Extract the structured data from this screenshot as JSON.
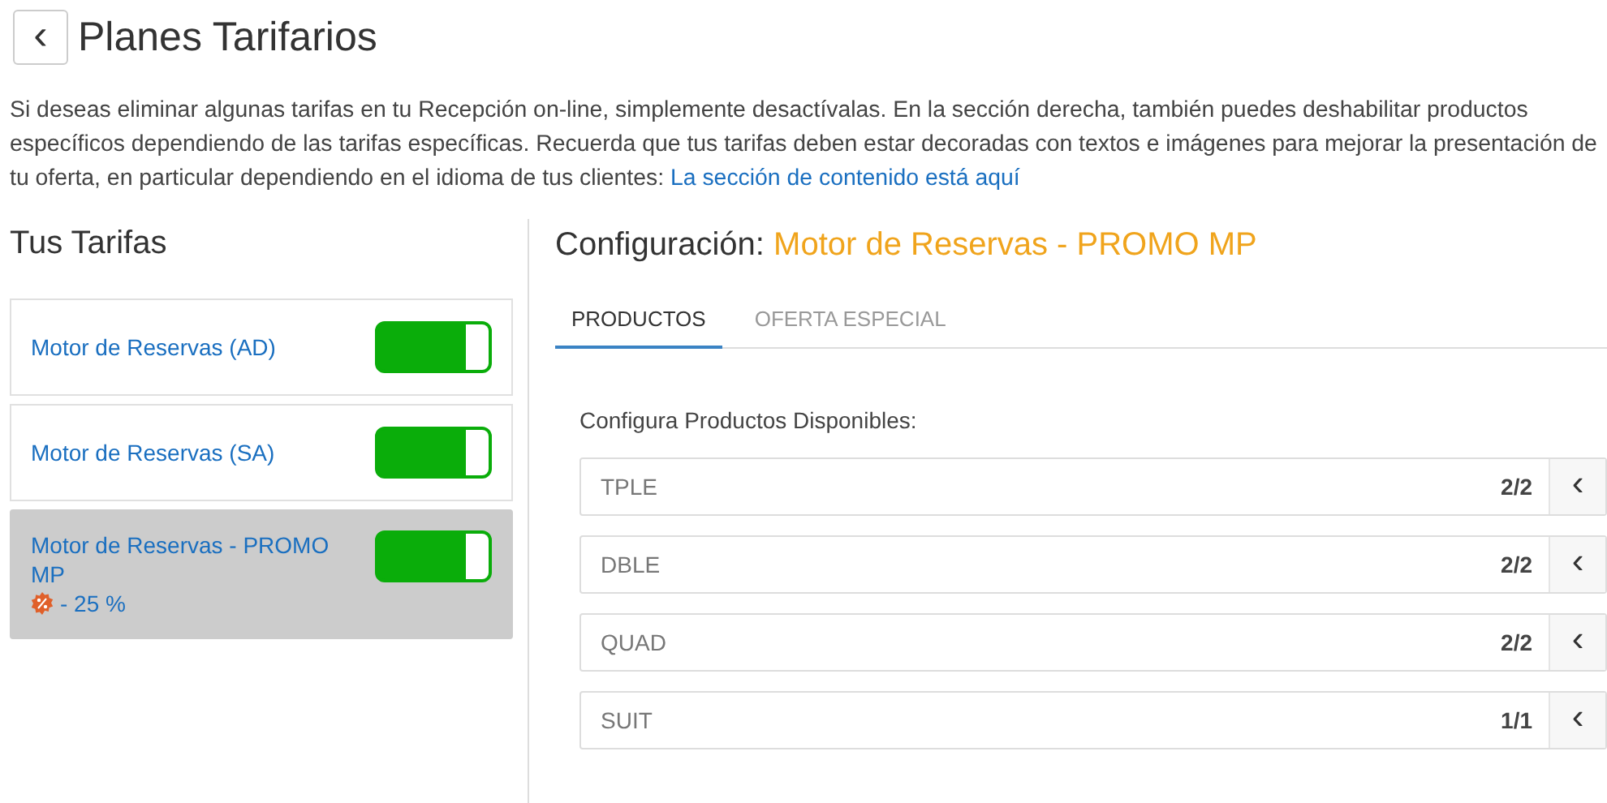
{
  "header": {
    "back_button": "‹",
    "title": "Planes Tarifarios"
  },
  "intro": {
    "text": "Si deseas eliminar algunas tarifas en tu Recepción on-line, simplemente desactívalas. En la sección derecha, también puedes deshabilitar productos específicos dependiendo de las tarifas específicas. Recuerda que tus tarifas deben estar decoradas con textos e imágenes para mejorar la presentación de tu oferta, en particular dependiendo en el idioma de tus clientes:",
    "link": "La sección de contenido está aquí"
  },
  "rates": {
    "title": "Tus Tarifas",
    "items": [
      {
        "name": "Motor de Reservas (AD)",
        "selected": false,
        "on": true
      },
      {
        "name": "Motor de Reservas (SA)",
        "selected": false,
        "on": true
      },
      {
        "name": "Motor de Reservas - PROMO MP",
        "discount": "- 25 %",
        "selected": true,
        "on": true
      }
    ]
  },
  "config": {
    "label": "Configuración:",
    "rate_name": "Motor de Reservas - PROMO MP",
    "tabs": [
      {
        "label": "PRODUCTOS",
        "selected": true
      },
      {
        "label": "OFERTA ESPECIAL",
        "selected": false
      }
    ],
    "products_label": "Configura Productos Disponibles:",
    "products": [
      {
        "name": "TPLE",
        "count": "2/2",
        "expand": "‹"
      },
      {
        "name": "DBLE",
        "count": "2/2",
        "expand": "‹"
      },
      {
        "name": "QUAD",
        "count": "2/2",
        "expand": "‹"
      },
      {
        "name": "SUIT",
        "count": "1/1",
        "expand": "‹"
      }
    ]
  }
}
